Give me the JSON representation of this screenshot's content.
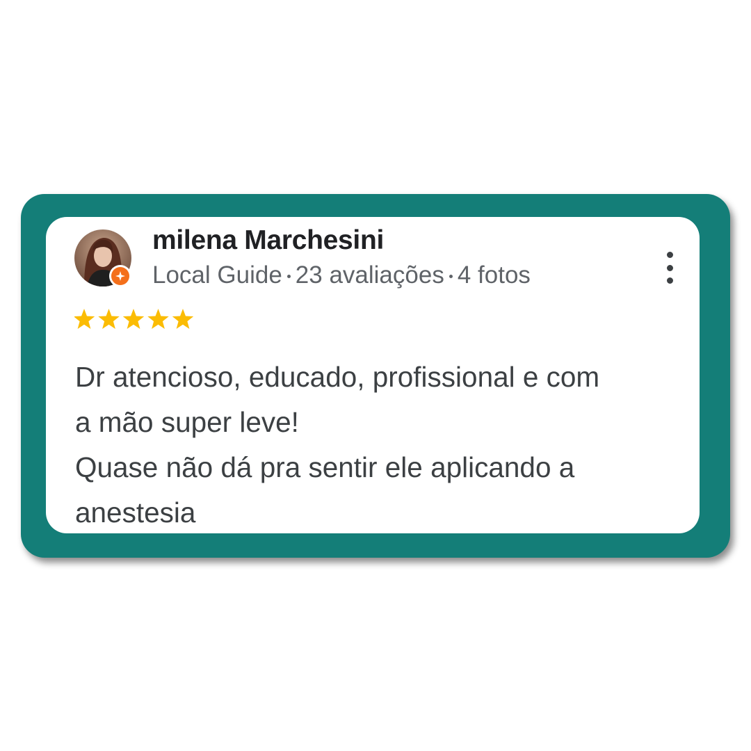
{
  "review": {
    "reviewer_name": "milena Marchesini",
    "reviewer_badge": "Local Guide",
    "review_count": "23 avaliações",
    "photo_count": "4 fotos",
    "rating": 5,
    "rating_max": 5,
    "text_lines": [
      "Dr atencioso, educado, profissional e com",
      "a mão super leve!",
      "Quase não dá pra sentir ele aplicando a",
      "anestesia"
    ]
  },
  "icons": {
    "avatar": "avatar-photo",
    "badge": "local-guide-star-icon",
    "menu": "more-vert-icon",
    "star": "star-icon"
  },
  "colors": {
    "frame": "#147e78",
    "card": "#ffffff",
    "star": "#fbbc04",
    "badge": "#f46f1b",
    "name": "#202124",
    "meta": "#5f6368",
    "body": "#3c4043"
  }
}
